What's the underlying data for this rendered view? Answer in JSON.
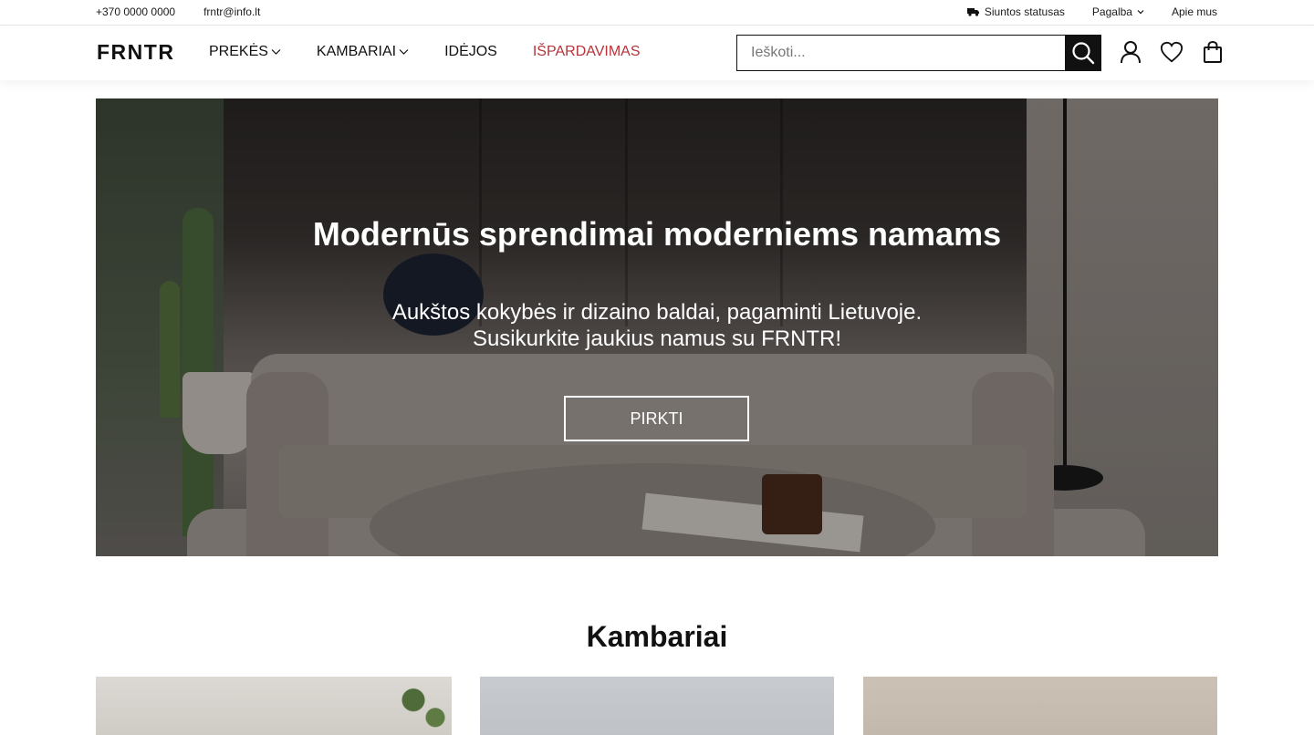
{
  "topbar": {
    "phone": "+370 0000 0000",
    "email": "frntr@info.lt",
    "shipping_status": "Siuntos statusas",
    "help": "Pagalba",
    "about": "Apie mus"
  },
  "header": {
    "logo": "FRNTR",
    "nav": [
      {
        "label": "PREKĖS",
        "dropdown": true
      },
      {
        "label": "KAMBARIAI",
        "dropdown": true
      },
      {
        "label": "IDĖJOS",
        "dropdown": false
      },
      {
        "label": "IŠPARDAVIMAS",
        "dropdown": false
      }
    ],
    "search_placeholder": "Ieškoti...",
    "icons": [
      "account-icon",
      "wishlist-heart-icon",
      "shopping-bag-icon"
    ]
  },
  "hero": {
    "title": "Modernūs sprendimai moderniems namams",
    "subtitle_line1": "Aukštos kokybės ir dizaino baldai, pagaminti Lietuvoje.",
    "subtitle_line2": "Susikurkite jaukius namus su FRNTR!",
    "cta": "PIRKTI"
  },
  "rooms": {
    "title": "Kambariai"
  },
  "colors": {
    "sale": "#b8333a",
    "primary": "#111111",
    "background": "#ffffff"
  }
}
